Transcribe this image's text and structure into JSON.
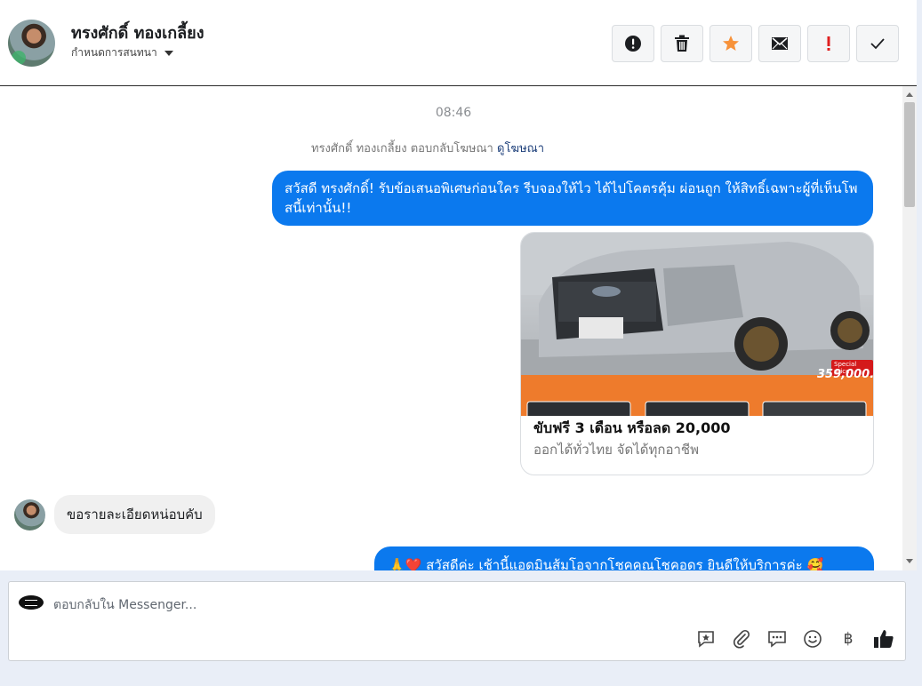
{
  "header": {
    "contact_name": "ทรงศักดิ์ ทองเกลี้ยง",
    "assign_label": "กำหนดการสนทนา",
    "actions": [
      {
        "icon": "alert-circle-icon",
        "label": "Spam"
      },
      {
        "icon": "trash-icon",
        "label": "Delete"
      },
      {
        "icon": "star-icon",
        "label": "Star",
        "color": "#f7923a"
      },
      {
        "icon": "envelope-icon",
        "label": "Mark unread"
      },
      {
        "icon": "exclamation-icon",
        "label": "Follow up",
        "color": "#e02020"
      },
      {
        "icon": "check-icon",
        "label": "Done"
      }
    ]
  },
  "conversation": {
    "time": "08:46",
    "ad_reply_text": "ทรงศักดิ์ ทองเกลี้ยง ตอบกลับโฆษณา",
    "ad_link": "ดูโฆษณา",
    "outgoing_1": "สวัสดี ทรงศักดิ์! รับข้อเสนอพิเศษก่อนใคร รีบจองให้ไว ได้ไปโคตรคุ้ม ผ่อนถูก ให้สิทธิ์เฉพาะผู้ที่เห็นโพสนี้เท่านั้น!!",
    "card": {
      "price_badge": "Special price",
      "price": "359,000.-",
      "title": "ขับฟรี 3 เดือน หรือลด 20,000",
      "subtitle": "ออกได้ทั่วไทย จัดได้ทุกอาชีพ"
    },
    "incoming_1": "ขอรายละเอียดหน่อบคับ",
    "outgoing_2": "🙏❤️ สวัสดีค่ะ เช้านี้แอดมินส้มโอจากโชคคูณโชคอดร ยินดีให้บริการค่ะ 🥰"
  },
  "composer": {
    "placeholder": "ตอบกลับใน Messenger...",
    "tools": [
      "saved-reply-icon",
      "attachment-icon",
      "chat-bubble-icon",
      "emoji-icon",
      "baht-icon",
      "thumbs-up-icon"
    ],
    "baht_symbol": "฿"
  },
  "colors": {
    "accent_blue": "#0b79ee",
    "star_orange": "#f7923a",
    "alert_red": "#e02020"
  }
}
